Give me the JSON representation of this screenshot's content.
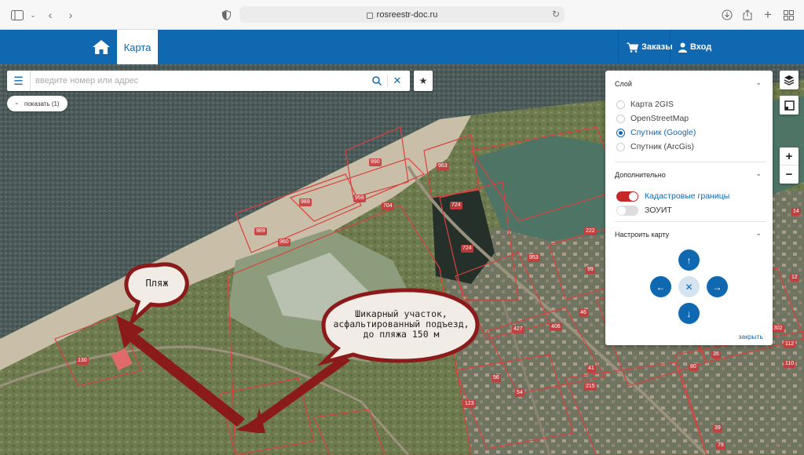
{
  "browser": {
    "url": "rosreestr-doc.ru",
    "icons": [
      "sidebar-icon",
      "back-icon",
      "forward-icon",
      "shield-icon",
      "download-icon",
      "share-icon",
      "new-tab-icon",
      "tabs-overview-icon"
    ]
  },
  "header": {
    "home_icon": "home-icon",
    "map_tab": "Карта",
    "orders": "Заказы",
    "login": "Вход",
    "brand_color": "#1068b0"
  },
  "search": {
    "placeholder": "введите номер или адрес"
  },
  "filter": {
    "show_label": "показать (1)"
  },
  "layers_panel": {
    "layer_title": "Слой",
    "layers": [
      {
        "label": "Карта 2GIS",
        "selected": false
      },
      {
        "label": "OpenStreetMap",
        "selected": false
      },
      {
        "label": "Спутник (Google)",
        "selected": true
      },
      {
        "label": "Спутник (ArcGis)",
        "selected": false
      }
    ],
    "extra_title": "Дополнительно",
    "toggles": [
      {
        "label": "Кадастровые границы",
        "on": true
      },
      {
        "label": "ЗОУИТ",
        "on": false
      }
    ],
    "settings_title": "Настроить карту",
    "close": "закрыть"
  },
  "map": {
    "bubble_beach": "Пляж",
    "bubble_plot": [
      "Шикарный участок,",
      "асфальтированный подъезд,",
      "до пляжа 150 м"
    ],
    "plot_numbers": [
      "990",
      "963",
      "989",
      "959",
      "704",
      "989",
      "960",
      "724",
      "724",
      "222",
      "953",
      "99",
      "46",
      "406",
      "427",
      "35",
      "80",
      "130",
      "123",
      "54",
      "215",
      "41",
      "56",
      "39",
      "79",
      "112",
      "110",
      "302",
      "14",
      "12"
    ],
    "accent_color": "#8b1a1a"
  }
}
